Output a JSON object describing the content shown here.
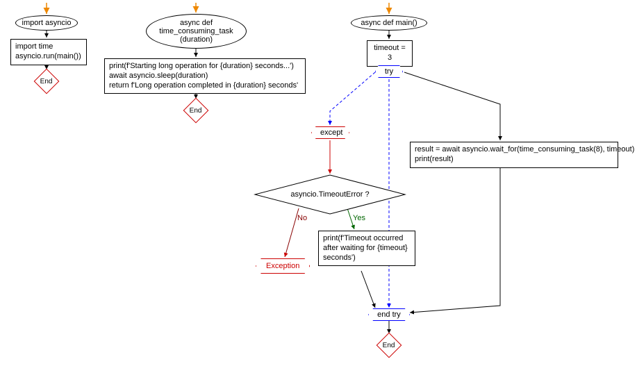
{
  "chart_data": {
    "type": "flowchart",
    "subgraphs": [
      {
        "name": "module",
        "nodes": [
          {
            "id": "n1",
            "shape": "ellipse",
            "text": "import asyncio"
          },
          {
            "id": "n2",
            "shape": "rect",
            "text": "import time\nasyncio.run(main())"
          },
          {
            "id": "n3",
            "shape": "end",
            "text": "End"
          }
        ],
        "edges": [
          [
            "entry",
            "n1"
          ],
          [
            "n1",
            "n2"
          ],
          [
            "n2",
            "n3"
          ]
        ]
      },
      {
        "name": "time_consuming_task",
        "nodes": [
          {
            "id": "t1",
            "shape": "ellipse",
            "text": "async def\ntime_consuming_task\n(duration)"
          },
          {
            "id": "t2",
            "shape": "rect",
            "text": "print(f'Starting long operation for {duration} seconds...')\nawait asyncio.sleep(duration)\nreturn f'Long operation completed in {duration} seconds'"
          },
          {
            "id": "t3",
            "shape": "end",
            "text": "End"
          }
        ],
        "edges": [
          [
            "entry",
            "t1"
          ],
          [
            "t1",
            "t2"
          ],
          [
            "t2",
            "t3"
          ]
        ]
      },
      {
        "name": "main",
        "nodes": [
          {
            "id": "m1",
            "shape": "ellipse",
            "text": "async def main()"
          },
          {
            "id": "m2",
            "shape": "rect",
            "text": "timeout = 3"
          },
          {
            "id": "m3",
            "shape": "hex",
            "text": "try"
          },
          {
            "id": "m4",
            "shape": "rect",
            "text": "result = await asyncio.wait_for(time_consuming_task(8), timeout)\nprint(result)"
          },
          {
            "id": "m5",
            "shape": "hex-red",
            "text": "except"
          },
          {
            "id": "m6",
            "shape": "decision",
            "text": "asyncio.TimeoutError ?"
          },
          {
            "id": "m7",
            "shape": "rect",
            "text": "print(f'Timeout occurred\nafter waiting for {timeout}\nseconds')"
          },
          {
            "id": "m8",
            "shape": "exception",
            "text": "Exception"
          },
          {
            "id": "m9",
            "shape": "hex",
            "text": "end try"
          },
          {
            "id": "m10",
            "shape": "end",
            "text": "End"
          }
        ],
        "edges": [
          [
            "entry",
            "m1"
          ],
          [
            "m1",
            "m2"
          ],
          [
            "m2",
            "m3"
          ],
          [
            "m3",
            "m4",
            "try-body"
          ],
          [
            "m3",
            "m5",
            "except-path"
          ],
          [
            "m3",
            "m9",
            "fallthrough"
          ],
          [
            "m4",
            "m9"
          ],
          [
            "m5",
            "m6"
          ],
          [
            "m6",
            "m7",
            "Yes"
          ],
          [
            "m6",
            "m8",
            "No"
          ],
          [
            "m7",
            "m9"
          ],
          [
            "m9",
            "m10"
          ]
        ]
      }
    ]
  },
  "left": {
    "start": "import asyncio",
    "body": "import time\nasyncio.run(main())",
    "end": "End"
  },
  "mid": {
    "start": "async def\ntime_consuming_task\n(duration)",
    "body": "print(f'Starting long operation for {duration} seconds...')\nawait asyncio.sleep(duration)\nreturn f'Long operation completed in {duration} seconds'",
    "end": "End"
  },
  "right": {
    "start": "async def main()",
    "timeout": "timeout = 3",
    "try": "try",
    "try_body": "result = await asyncio.wait_for(time_consuming_task(8), timeout)\nprint(result)",
    "except": "except",
    "decision": "asyncio.TimeoutError ?",
    "yes": "Yes",
    "no": "No",
    "timeout_print": "print(f'Timeout occurred\nafter waiting for {timeout}\nseconds')",
    "exception": "Exception",
    "end_try": "end try",
    "end": "End"
  }
}
